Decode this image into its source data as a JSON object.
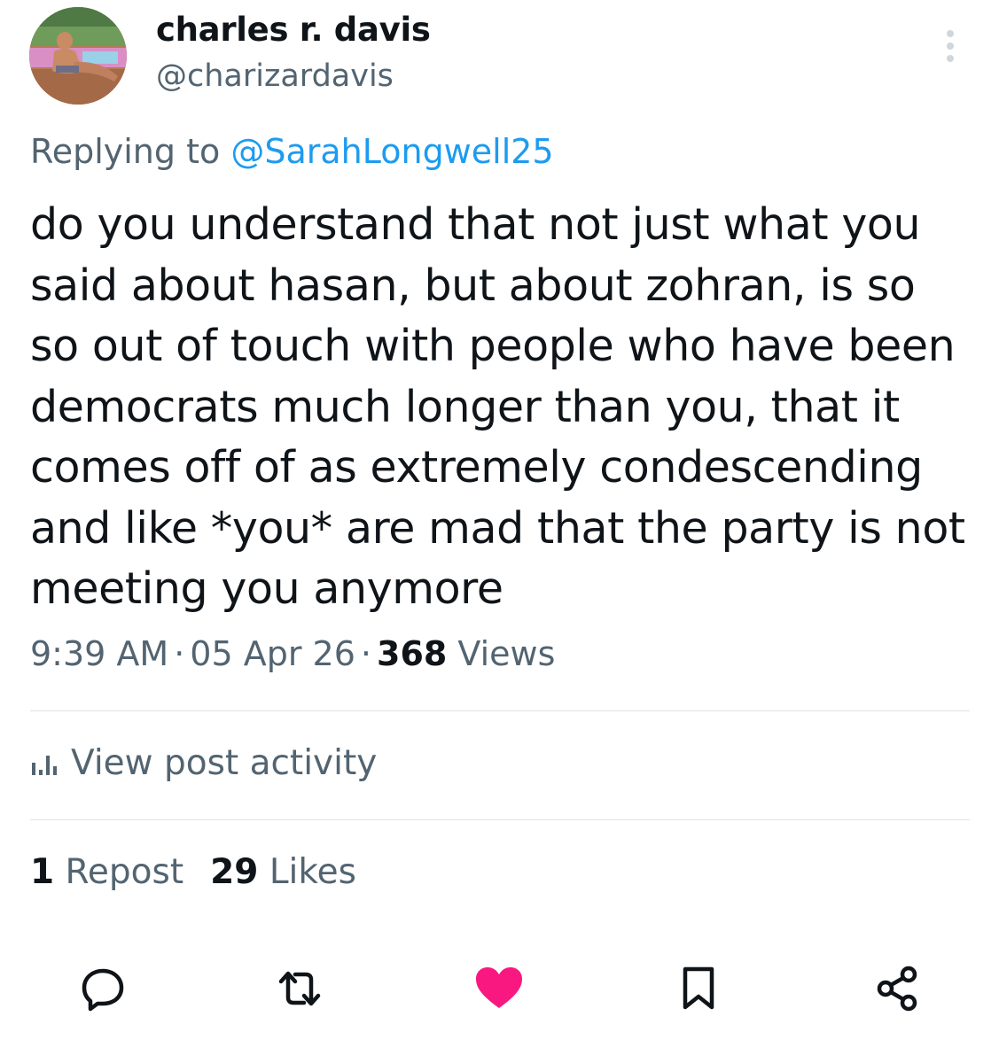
{
  "author": {
    "display_name": "charles r. davis",
    "handle": "@charizardavis"
  },
  "reply": {
    "prefix": "Replying to",
    "mention": "@SarahLongwell25"
  },
  "tweet": {
    "lines": [
      "do you understand that not just what you",
      "said about hasan, but about zohran, is so",
      "so out of touch with people who have been",
      "democrats much longer than you, that it",
      "comes off of as extremely condescending",
      "and like *you* are mad that the party is not",
      "meeting you anymore"
    ]
  },
  "meta": {
    "time": "9:39 AM",
    "separator": "·",
    "date": "05 Apr 26",
    "views_count": "368",
    "views_label": "Views"
  },
  "activity": {
    "label": "View post activity"
  },
  "stats": {
    "reposts_count": "1",
    "reposts_label": "Repost",
    "likes_count": "29",
    "likes_label": "Likes"
  },
  "actions": {
    "icons": [
      "reply-icon",
      "repost-icon",
      "like-icon",
      "bookmark-icon",
      "share-icon"
    ],
    "liked": true
  },
  "colors": {
    "text_primary": "#0f1419",
    "text_secondary": "#536471",
    "accent_blue": "#1d9bf0",
    "like_pink": "#f91880"
  }
}
